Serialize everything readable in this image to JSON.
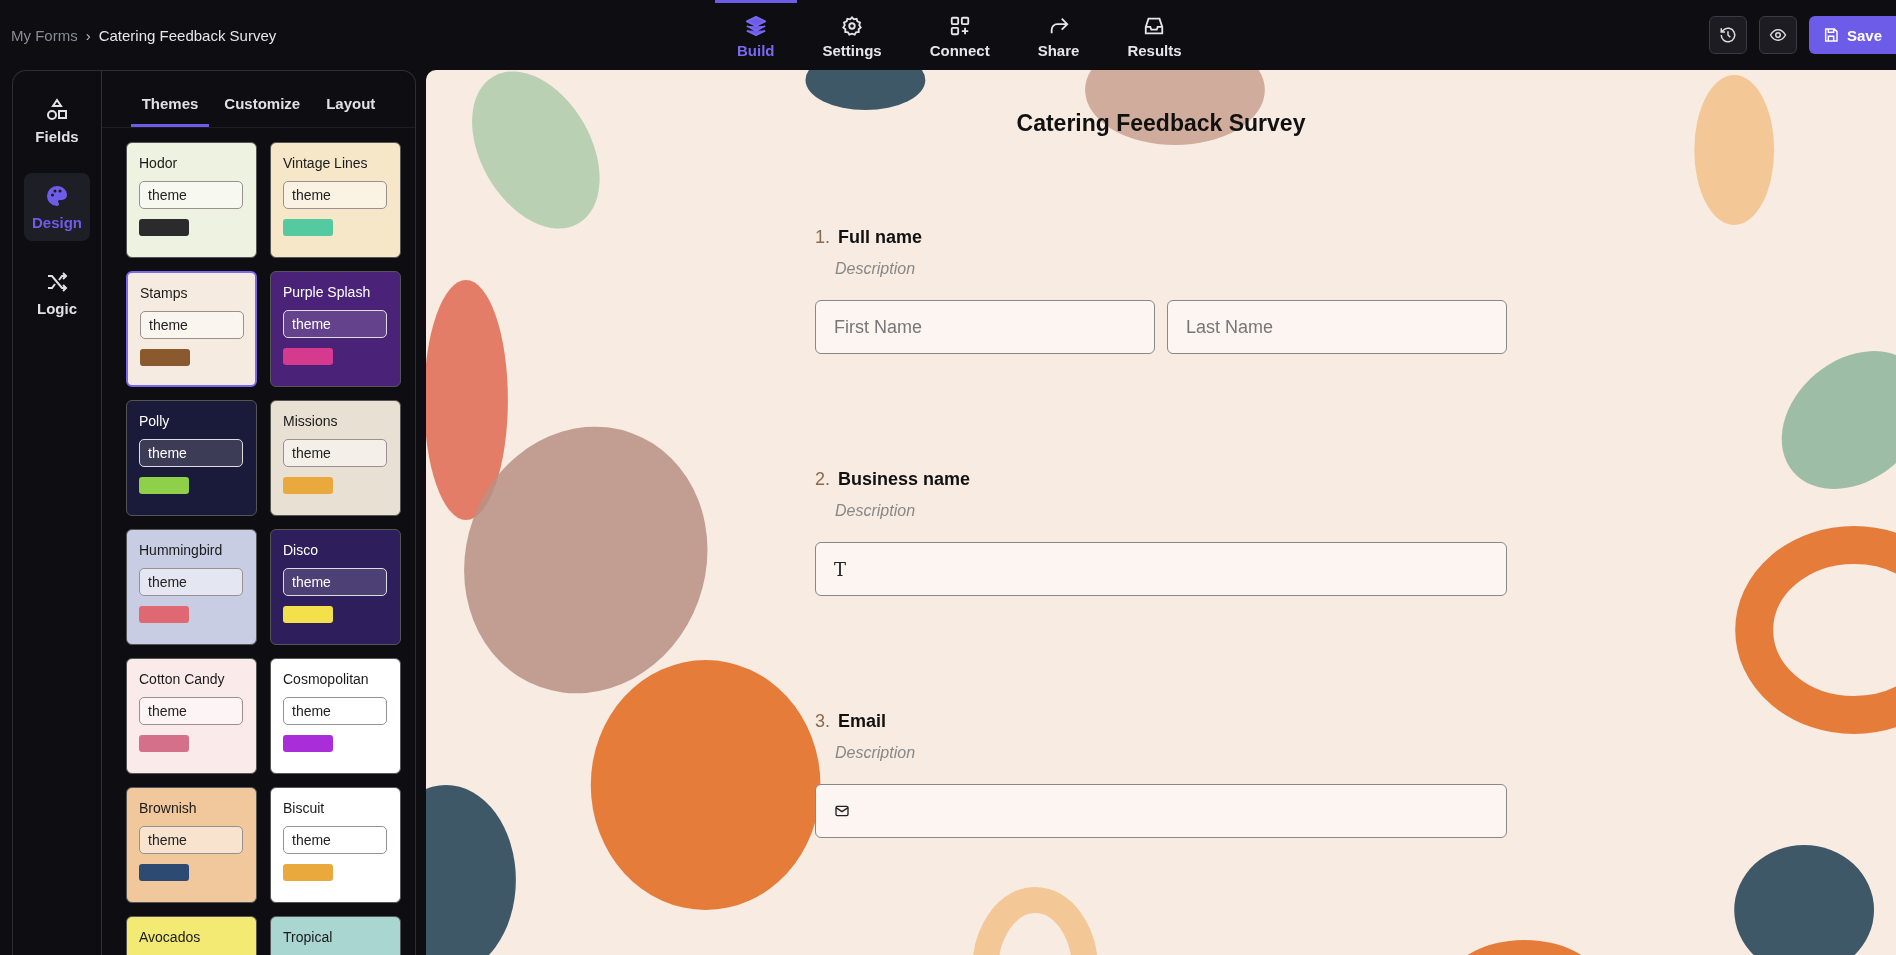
{
  "breadcrumb": {
    "parent": "My Forms",
    "separator": "›",
    "current": "Catering Feedback Survey"
  },
  "nav": [
    {
      "kind": "build",
      "label": "Build",
      "selected": true
    },
    {
      "kind": "settings",
      "label": "Settings",
      "selected": false
    },
    {
      "kind": "connect",
      "label": "Connect",
      "selected": false
    },
    {
      "kind": "share",
      "label": "Share",
      "selected": false
    },
    {
      "kind": "results",
      "label": "Results",
      "selected": false
    }
  ],
  "actions": {
    "save": "Save"
  },
  "rail": [
    {
      "kind": "fields",
      "label": "Fields",
      "selected": false
    },
    {
      "kind": "design",
      "label": "Design",
      "selected": true
    },
    {
      "kind": "logic",
      "label": "Logic",
      "selected": false
    }
  ],
  "panel_tabs": [
    {
      "label": "Themes",
      "selected": true
    },
    {
      "label": "Customize",
      "selected": false
    },
    {
      "label": "Layout",
      "selected": false
    }
  ],
  "themes": [
    {
      "kind": "light",
      "name": "Hodor",
      "field": "theme",
      "color": "#2b2b2b",
      "selected": false
    },
    {
      "kind": "cream",
      "name": "Vintage Lines",
      "field": "theme",
      "color": "#55c9a0",
      "selected": false
    },
    {
      "kind": "paper",
      "name": "Stamps",
      "field": "theme",
      "color": "#8a5a2e",
      "selected": true
    },
    {
      "kind": "purple",
      "name": "Purple Splash",
      "field": "theme",
      "color": "#d63a8f",
      "selected": false
    },
    {
      "kind": "navy",
      "name": "Polly",
      "field": "theme",
      "color": "#8ed04a",
      "selected": false
    },
    {
      "kind": "sand",
      "name": "Missions",
      "field": "theme",
      "color": "#eaa93c",
      "selected": false
    },
    {
      "kind": "lavender",
      "name": "Hummingbird",
      "field": "theme",
      "color": "#e06872",
      "selected": false
    },
    {
      "kind": "violet",
      "name": "Disco",
      "field": "theme",
      "color": "#f4e04a",
      "selected": false
    },
    {
      "kind": "blush",
      "name": "Cotton Candy",
      "field": "theme",
      "color": "#d4708a",
      "selected": false
    },
    {
      "kind": "white",
      "name": "Cosmopolitan",
      "field": "theme",
      "color": "#a92dd8",
      "selected": false
    },
    {
      "kind": "peach",
      "name": "Brownish",
      "field": "theme",
      "color": "#2d4a72",
      "selected": false
    },
    {
      "kind": "white",
      "name": "Biscuit",
      "field": "theme",
      "color": "#eaa93c",
      "selected": false
    },
    {
      "kind": "lemon",
      "name": "Avocados",
      "selected": false
    },
    {
      "kind": "aqua",
      "name": "Tropical",
      "selected": false
    }
  ],
  "form": {
    "title": "Catering Feedback Survey",
    "questions": [
      {
        "number": "1.",
        "label": "Full name",
        "description": "Description",
        "kind": "name",
        "placeholders": [
          "First Name",
          "Last Name"
        ]
      },
      {
        "number": "2.",
        "label": "Business name",
        "description": "Description",
        "kind": "text",
        "icon": "T"
      },
      {
        "number": "3.",
        "label": "Email",
        "description": "Description",
        "kind": "email"
      }
    ]
  }
}
